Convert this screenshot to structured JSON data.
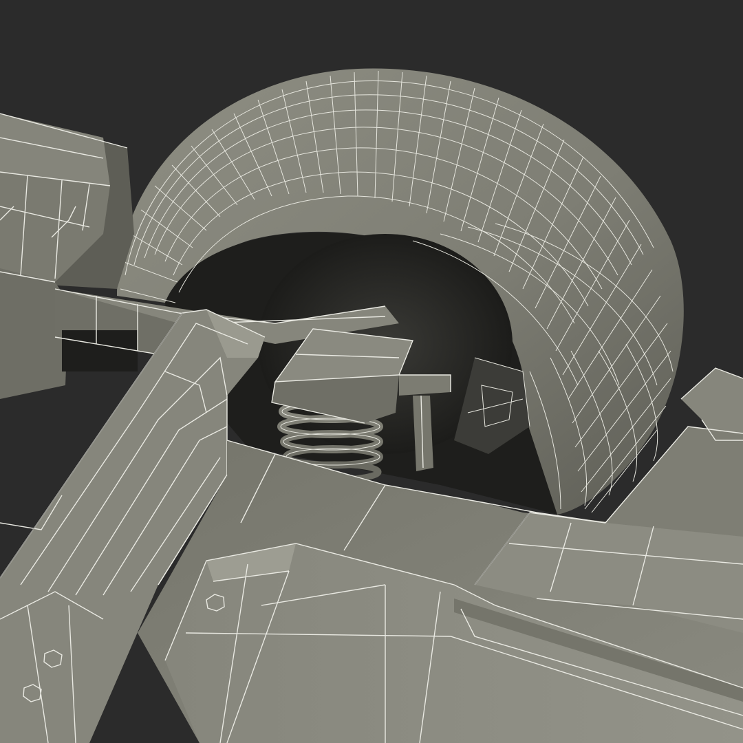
{
  "scene": {
    "colors": {
      "background": "#2b2b2b",
      "surface_light": "#8d8d82",
      "surface_mid": "#76766c",
      "surface_dark": "#55554d",
      "shadow": "#222220",
      "wireframe": "#e9e9e2"
    }
  }
}
